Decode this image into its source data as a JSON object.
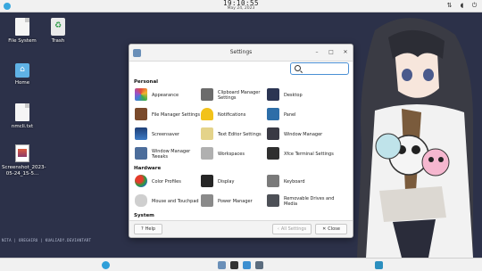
{
  "top_panel": {
    "time": "19:10:55",
    "date": "May 24, 2023"
  },
  "desktop": {
    "icons": [
      {
        "label": "File System"
      },
      {
        "label": "Trash"
      },
      {
        "label": "Home"
      },
      {
        "label": "nmcli.txt"
      },
      {
        "label": "Screenshot_2023-05-24_15-5..."
      }
    ],
    "strip_text": "NITA  |  OREGAIRU  |  KUALIADY.DEVIANTART"
  },
  "window": {
    "title": "Settings",
    "search": {
      "value": "",
      "placeholder": ""
    },
    "sections": [
      {
        "title": "Personal",
        "items": [
          {
            "label": "Appearance",
            "icon": "appearance-icon",
            "color": "#e89a3c"
          },
          {
            "label": "Clipboard Manager Settings",
            "icon": "clipboard-icon",
            "color": "#6b6b6b"
          },
          {
            "label": "Desktop",
            "icon": "desktop-icon",
            "color": "#2b3553"
          },
          {
            "label": "File Manager Settings",
            "icon": "file-manager-icon",
            "color": "#7a4a2b"
          },
          {
            "label": "Notifications",
            "icon": "notifications-icon",
            "color": "#f2c21a"
          },
          {
            "label": "Panel",
            "icon": "panel-icon",
            "color": "#2d6ea8"
          },
          {
            "label": "Screensaver",
            "icon": "screensaver-icon",
            "color": "#1f3f77"
          },
          {
            "label": "Text Editor Settings",
            "icon": "text-editor-icon",
            "color": "#e4d38a"
          },
          {
            "label": "Window Manager",
            "icon": "window-manager-icon",
            "color": "#3a3a44"
          },
          {
            "label": "Window Manager Tweaks",
            "icon": "wm-tweaks-icon",
            "color": "#4c6d9b"
          },
          {
            "label": "Workspaces",
            "icon": "workspaces-icon",
            "color": "#b0b0b0"
          },
          {
            "label": "Xfce Terminal Settings",
            "icon": "terminal-icon",
            "color": "#2f2f2f"
          }
        ]
      },
      {
        "title": "Hardware",
        "items": [
          {
            "label": "Color Profiles",
            "icon": "color-profiles-icon",
            "color": "#d9472b"
          },
          {
            "label": "Display",
            "icon": "display-icon",
            "color": "#262626"
          },
          {
            "label": "Keyboard",
            "icon": "keyboard-icon",
            "color": "#7a7a7a"
          },
          {
            "label": "Mouse and Touchpad",
            "icon": "mouse-icon",
            "color": "#cfcfcf"
          },
          {
            "label": "Power Manager",
            "icon": "power-manager-icon",
            "color": "#8a8a8a"
          },
          {
            "label": "Removable Drives and Media",
            "icon": "removable-drives-icon",
            "color": "#4d5057"
          }
        ]
      },
      {
        "title": "System",
        "items": [
          {
            "label": "",
            "icon": "system-item-icon",
            "color": "#2f8fd2"
          },
          {
            "label": "",
            "icon": "system-item-icon",
            "color": "#c8692e"
          },
          {
            "label": "",
            "icon": "system-item-icon",
            "color": "#2ea4d1"
          }
        ]
      }
    ],
    "buttons": {
      "help": "Help",
      "all_settings": "All Settings",
      "close": "Close"
    }
  }
}
